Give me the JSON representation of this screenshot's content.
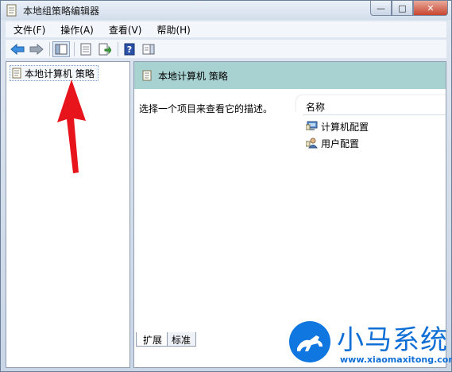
{
  "window": {
    "title": "本地组策略编辑器",
    "controls": {
      "minimize": "—",
      "maximize": "□",
      "close": "✕"
    }
  },
  "menu": [
    {
      "label": "文件(F)"
    },
    {
      "label": "操作(A)"
    },
    {
      "label": "查看(V)"
    },
    {
      "label": "帮助(H)"
    }
  ],
  "toolbar": {
    "icons": [
      "back-arrow-icon",
      "forward-arrow-icon",
      "show-hide-tree-icon",
      "properties-icon",
      "export-list-icon",
      "help-icon",
      "show-action-pane-icon"
    ]
  },
  "tree": {
    "root_label": "本地计算机 策略"
  },
  "details": {
    "header_title": "本地计算机 策略",
    "description": "选择一个项目来查看它的描述。",
    "column_name": "名称",
    "rows": [
      {
        "label": "计算机配置",
        "icon": "computer-config-icon"
      },
      {
        "label": "用户配置",
        "icon": "user-config-icon"
      }
    ],
    "tabs": [
      {
        "label": "扩展"
      },
      {
        "label": "标准"
      }
    ]
  },
  "watermark": {
    "brand": "小马系统",
    "url": "www.xiaomaxitong.com"
  },
  "colors": {
    "header_band": "#a8d1d1",
    "arrow": "#e8141c",
    "watermark": "#0f6fd6"
  }
}
